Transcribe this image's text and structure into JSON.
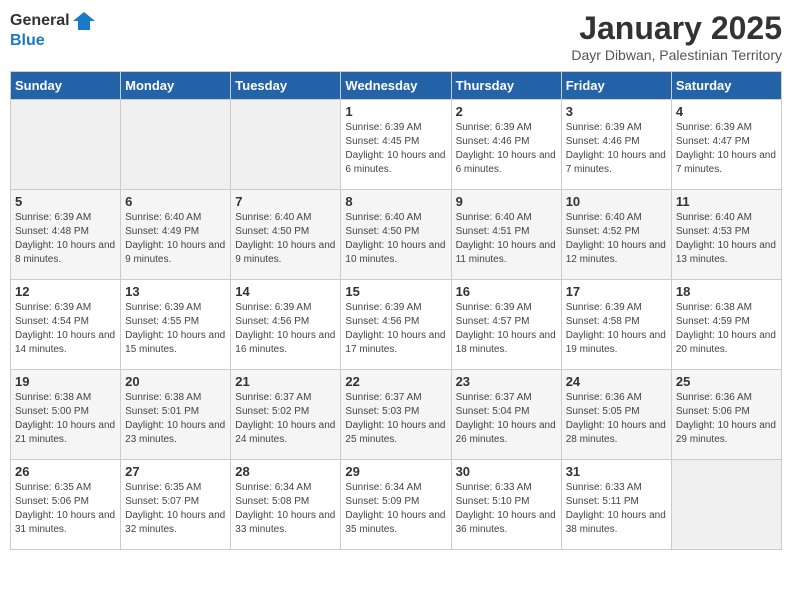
{
  "header": {
    "logo_general": "General",
    "logo_blue": "Blue",
    "title": "January 2025",
    "subtitle": "Dayr Dibwan, Palestinian Territory"
  },
  "days_of_week": [
    "Sunday",
    "Monday",
    "Tuesday",
    "Wednesday",
    "Thursday",
    "Friday",
    "Saturday"
  ],
  "weeks": [
    [
      {
        "day": "",
        "info": ""
      },
      {
        "day": "",
        "info": ""
      },
      {
        "day": "",
        "info": ""
      },
      {
        "day": "1",
        "info": "Sunrise: 6:39 AM\nSunset: 4:45 PM\nDaylight: 10 hours and 6 minutes."
      },
      {
        "day": "2",
        "info": "Sunrise: 6:39 AM\nSunset: 4:46 PM\nDaylight: 10 hours and 6 minutes."
      },
      {
        "day": "3",
        "info": "Sunrise: 6:39 AM\nSunset: 4:46 PM\nDaylight: 10 hours and 7 minutes."
      },
      {
        "day": "4",
        "info": "Sunrise: 6:39 AM\nSunset: 4:47 PM\nDaylight: 10 hours and 7 minutes."
      }
    ],
    [
      {
        "day": "5",
        "info": "Sunrise: 6:39 AM\nSunset: 4:48 PM\nDaylight: 10 hours and 8 minutes."
      },
      {
        "day": "6",
        "info": "Sunrise: 6:40 AM\nSunset: 4:49 PM\nDaylight: 10 hours and 9 minutes."
      },
      {
        "day": "7",
        "info": "Sunrise: 6:40 AM\nSunset: 4:50 PM\nDaylight: 10 hours and 9 minutes."
      },
      {
        "day": "8",
        "info": "Sunrise: 6:40 AM\nSunset: 4:50 PM\nDaylight: 10 hours and 10 minutes."
      },
      {
        "day": "9",
        "info": "Sunrise: 6:40 AM\nSunset: 4:51 PM\nDaylight: 10 hours and 11 minutes."
      },
      {
        "day": "10",
        "info": "Sunrise: 6:40 AM\nSunset: 4:52 PM\nDaylight: 10 hours and 12 minutes."
      },
      {
        "day": "11",
        "info": "Sunrise: 6:40 AM\nSunset: 4:53 PM\nDaylight: 10 hours and 13 minutes."
      }
    ],
    [
      {
        "day": "12",
        "info": "Sunrise: 6:39 AM\nSunset: 4:54 PM\nDaylight: 10 hours and 14 minutes."
      },
      {
        "day": "13",
        "info": "Sunrise: 6:39 AM\nSunset: 4:55 PM\nDaylight: 10 hours and 15 minutes."
      },
      {
        "day": "14",
        "info": "Sunrise: 6:39 AM\nSunset: 4:56 PM\nDaylight: 10 hours and 16 minutes."
      },
      {
        "day": "15",
        "info": "Sunrise: 6:39 AM\nSunset: 4:56 PM\nDaylight: 10 hours and 17 minutes."
      },
      {
        "day": "16",
        "info": "Sunrise: 6:39 AM\nSunset: 4:57 PM\nDaylight: 10 hours and 18 minutes."
      },
      {
        "day": "17",
        "info": "Sunrise: 6:39 AM\nSunset: 4:58 PM\nDaylight: 10 hours and 19 minutes."
      },
      {
        "day": "18",
        "info": "Sunrise: 6:38 AM\nSunset: 4:59 PM\nDaylight: 10 hours and 20 minutes."
      }
    ],
    [
      {
        "day": "19",
        "info": "Sunrise: 6:38 AM\nSunset: 5:00 PM\nDaylight: 10 hours and 21 minutes."
      },
      {
        "day": "20",
        "info": "Sunrise: 6:38 AM\nSunset: 5:01 PM\nDaylight: 10 hours and 23 minutes."
      },
      {
        "day": "21",
        "info": "Sunrise: 6:37 AM\nSunset: 5:02 PM\nDaylight: 10 hours and 24 minutes."
      },
      {
        "day": "22",
        "info": "Sunrise: 6:37 AM\nSunset: 5:03 PM\nDaylight: 10 hours and 25 minutes."
      },
      {
        "day": "23",
        "info": "Sunrise: 6:37 AM\nSunset: 5:04 PM\nDaylight: 10 hours and 26 minutes."
      },
      {
        "day": "24",
        "info": "Sunrise: 6:36 AM\nSunset: 5:05 PM\nDaylight: 10 hours and 28 minutes."
      },
      {
        "day": "25",
        "info": "Sunrise: 6:36 AM\nSunset: 5:06 PM\nDaylight: 10 hours and 29 minutes."
      }
    ],
    [
      {
        "day": "26",
        "info": "Sunrise: 6:35 AM\nSunset: 5:06 PM\nDaylight: 10 hours and 31 minutes."
      },
      {
        "day": "27",
        "info": "Sunrise: 6:35 AM\nSunset: 5:07 PM\nDaylight: 10 hours and 32 minutes."
      },
      {
        "day": "28",
        "info": "Sunrise: 6:34 AM\nSunset: 5:08 PM\nDaylight: 10 hours and 33 minutes."
      },
      {
        "day": "29",
        "info": "Sunrise: 6:34 AM\nSunset: 5:09 PM\nDaylight: 10 hours and 35 minutes."
      },
      {
        "day": "30",
        "info": "Sunrise: 6:33 AM\nSunset: 5:10 PM\nDaylight: 10 hours and 36 minutes."
      },
      {
        "day": "31",
        "info": "Sunrise: 6:33 AM\nSunset: 5:11 PM\nDaylight: 10 hours and 38 minutes."
      },
      {
        "day": "",
        "info": ""
      }
    ]
  ]
}
